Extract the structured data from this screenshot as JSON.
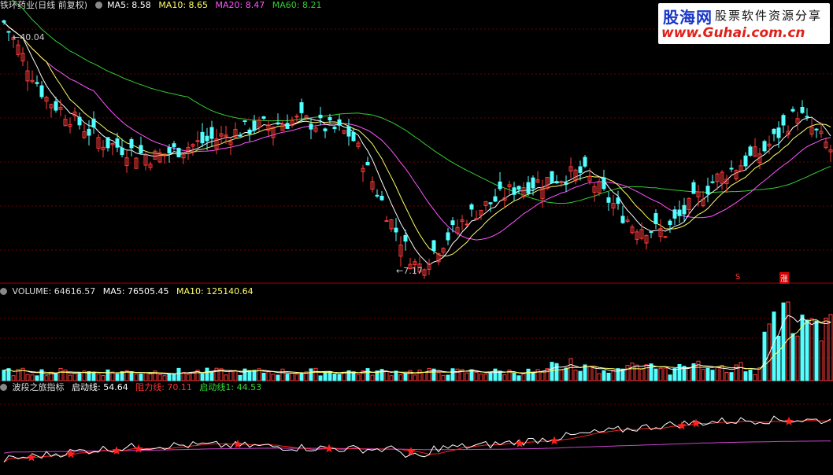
{
  "header_price": {
    "title": "铁环药业(日线 前复权)",
    "ma5": "MA5: 8.58",
    "ma10": "MA10: 8.65",
    "ma20": "MA20: 8.47",
    "ma60": "MA60: 8.21"
  },
  "header_volume": {
    "volume": "VOLUME: 64616.57",
    "ma5": "MA5: 76505.45",
    "ma10": "MA10: 125140.64"
  },
  "header_indicator": {
    "name": "波段之旅指标",
    "start_line": "启动线: 54.64",
    "resist_line": "阻力线: 70.11",
    "start_line1": "启动线1: 44.53"
  },
  "annotations": {
    "high_price": "40.04",
    "low_price": "7.17",
    "marker_s": "S",
    "marker_up": "涨"
  },
  "watermark": {
    "brand": "股海网",
    "slogan": "股票软件资源分享",
    "url": "www.Guhai.com.cn"
  },
  "colors": {
    "background": "#000000",
    "up": "#ff3b3b",
    "down": "#54ffff",
    "ma5": "#ffffff",
    "ma10": "#ffff66",
    "ma20": "#ff55ff",
    "ma60": "#33cc33",
    "grid": "#6b0000",
    "indicator_main": "#ffffff",
    "indicator_resist": "#ff2020",
    "indicator_slow": "#cc44cc",
    "star": "#ff2020"
  },
  "chart_data": {
    "type": "candlestick",
    "price_range": [
      7.17,
      40.04
    ],
    "trend_keypoints": [
      {
        "t": 0,
        "close": 40.04
      },
      {
        "t": 0.05,
        "close": 30
      },
      {
        "t": 0.12,
        "close": 24
      },
      {
        "t": 0.18,
        "close": 22
      },
      {
        "t": 0.3,
        "close": 26
      },
      {
        "t": 0.36,
        "close": 27
      },
      {
        "t": 0.42,
        "close": 25
      },
      {
        "t": 0.47,
        "close": 13
      },
      {
        "t": 0.5,
        "close": 7.17
      },
      {
        "t": 0.56,
        "close": 14
      },
      {
        "t": 0.62,
        "close": 18
      },
      {
        "t": 0.7,
        "close": 20
      },
      {
        "t": 0.76,
        "close": 13
      },
      {
        "t": 0.8,
        "close": 12
      },
      {
        "t": 0.86,
        "close": 19
      },
      {
        "t": 0.92,
        "close": 23
      },
      {
        "t": 0.96,
        "close": 28
      },
      {
        "t": 1.0,
        "close": 23
      }
    ],
    "indicator_values": {
      "start_line": 54.64,
      "resist_line": 70.11,
      "start_line1": 44.53
    }
  }
}
